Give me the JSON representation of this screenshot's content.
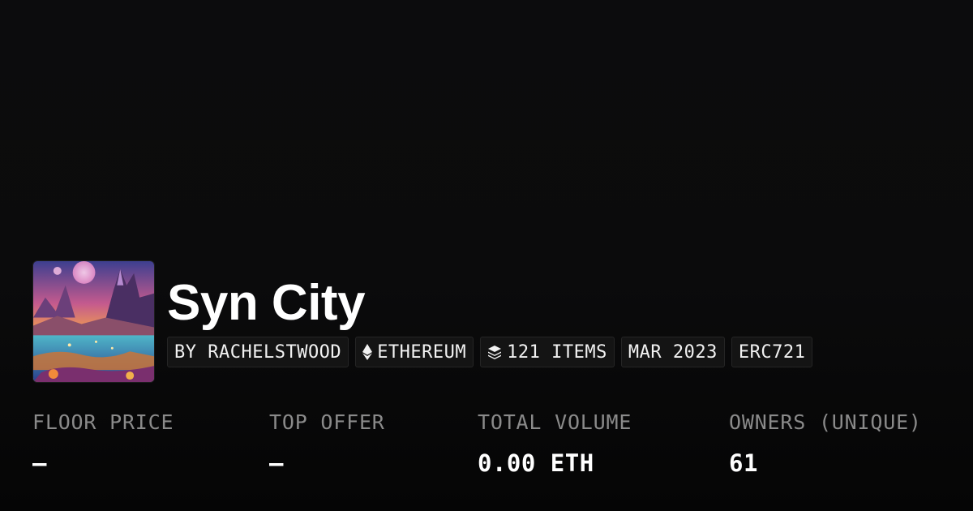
{
  "collection": {
    "name": "Syn City",
    "thumbnail_icon": "fantasy-landscape-image"
  },
  "tags": {
    "creator": "BY RACHELSTWOOD",
    "chain": "ETHEREUM",
    "chain_icon": "ethereum-icon",
    "items": "121 ITEMS",
    "items_icon": "layers-icon",
    "date": "MAR 2023",
    "standard": "ERC721"
  },
  "stats": {
    "floor_price": {
      "label": "FLOOR PRICE",
      "value": "–"
    },
    "top_offer": {
      "label": "TOP OFFER",
      "value": "–"
    },
    "total_volume": {
      "label": "TOTAL VOLUME",
      "value": "0.00 ETH"
    },
    "owners": {
      "label": "OWNERS (UNIQUE)",
      "value": "61"
    }
  },
  "colors": {
    "background": "#0b0b0c",
    "tag_background": "#141414",
    "label": "#8a8a8a",
    "text": "#ffffff"
  }
}
